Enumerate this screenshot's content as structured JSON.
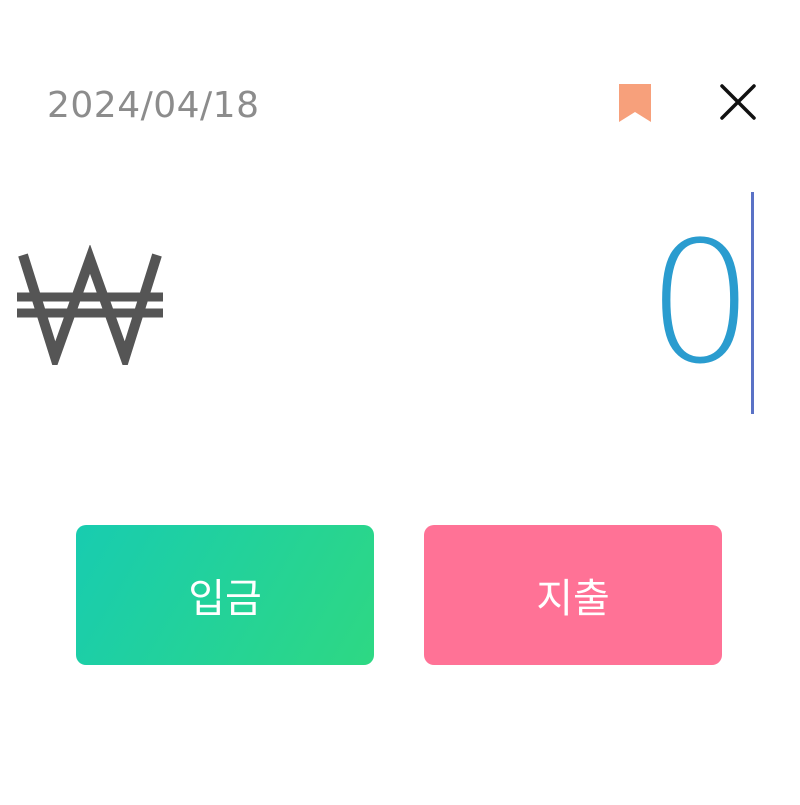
{
  "header": {
    "date": "2024/04/18",
    "bookmark_icon": "bookmark-icon",
    "close_icon": "close-icon"
  },
  "amount": {
    "currency_symbol": "₩",
    "value": "0"
  },
  "actions": {
    "income_label": "입금",
    "expense_label": "지출"
  },
  "colors": {
    "date_text": "#8c8c8c",
    "bookmark": "#f7a07b",
    "amount_text": "#2a9ccf",
    "caret": "#5a72c6",
    "income_start": "#18ccb0",
    "income_end": "#2ed883",
    "expense": "#ff7296"
  }
}
